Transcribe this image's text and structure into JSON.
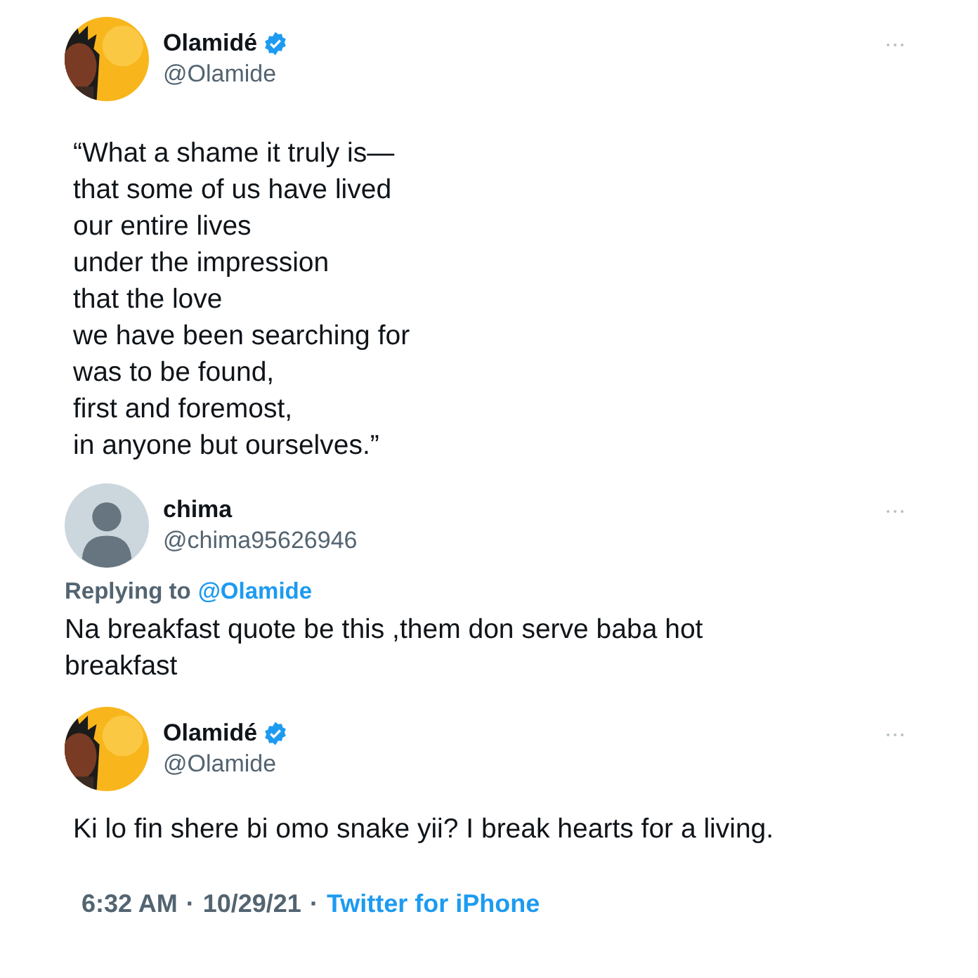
{
  "tweets": [
    {
      "kind": "main",
      "name": "Olamidé",
      "verified": true,
      "handle": "@Olamide",
      "lines": [
        "“What a shame it truly is—",
        "that some of us have lived",
        "our entire lives",
        "under the impression",
        "that the love",
        "we have been searching for",
        "was to be found,",
        "first and foremost,",
        "in anyone but ourselves.”"
      ]
    },
    {
      "kind": "reply",
      "name": "chima",
      "verified": false,
      "handle": "@chima95626946",
      "avatar": {
        "kind": "default"
      },
      "replying_label": "Replying to",
      "replying_to": "@Olamide",
      "lines": [
        "Na breakfast quote be this ,them don serve baba hot breakfast"
      ]
    },
    {
      "kind": "reply",
      "name": "Olamidé",
      "verified": true,
      "handle": "@Olamide",
      "lines": [
        "Ki lo fin shere bi omo snake yii? I break hearts for a living."
      ]
    }
  ],
  "meta": {
    "time": "6:32 AM",
    "separator_1": "·",
    "date": "10/29/21",
    "separator_2": "·",
    "source": "Twitter for iPhone"
  }
}
